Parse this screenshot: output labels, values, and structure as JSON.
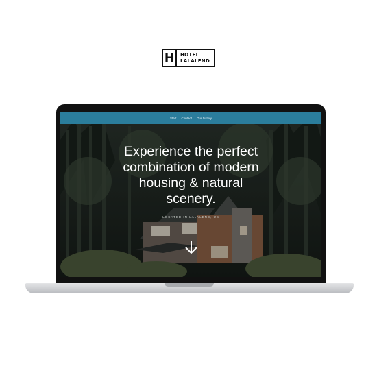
{
  "brand": {
    "mark": "H",
    "line1": "HOTEL",
    "line2": "LALALEND"
  },
  "nav": {
    "items": [
      "Start",
      "Contact",
      "Our history"
    ]
  },
  "hero": {
    "title_lines": [
      "Experience the perfect",
      "combination of modern",
      "housing & natural",
      "scenery."
    ],
    "subtitle": "LOCATED IN LALALEND, US"
  },
  "icons": {
    "scroll": "arrow-down-icon",
    "logo": "hotel-logo"
  },
  "colors": {
    "nav_bar": "#2b7d9c",
    "hero_text": "#ffffff",
    "lid": "#111111"
  }
}
